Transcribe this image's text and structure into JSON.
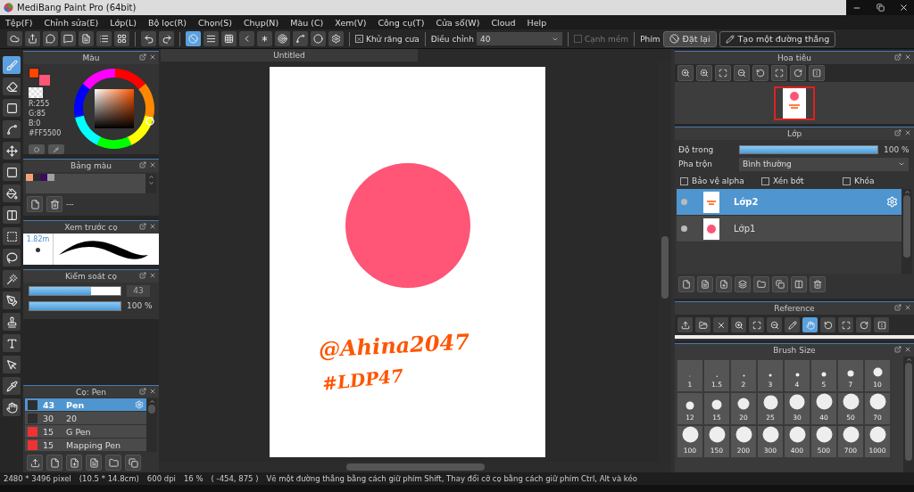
{
  "window": {
    "title": "MediBang Paint Pro (64bit)"
  },
  "menu": [
    "Tệp(F)",
    "Chỉnh sửa(E)",
    "Lớp(L)",
    "Bộ lọc(R)",
    "Chọn(S)",
    "Chụp(N)",
    "Màu (C)",
    "Xem(V)",
    "Công cụ(T)",
    "Cửa sổ(W)",
    "Cloud",
    "Help"
  ],
  "toolbar": {
    "rulers": [
      {
        "selected": true
      },
      {
        "selected": false
      },
      {
        "selected": false
      },
      {
        "selected": false
      },
      {
        "selected": false
      },
      {
        "selected": false
      },
      {
        "selected": false
      },
      {
        "selected": false
      },
      {
        "selected": false
      }
    ],
    "antialias": {
      "label": "Khử răng cưa",
      "checked": true
    },
    "adjust": {
      "label": "Điều chỉnh",
      "value": "40"
    },
    "soft_edge": {
      "label": "Cạnh mềm",
      "checked": false,
      "disabled": true
    },
    "key_label": "Phím",
    "reset_button": "Đặt lại",
    "line_button": "Tạo một đường thẳng"
  },
  "tools": [
    {
      "selected": true
    },
    {
      "selected": false
    },
    {
      "selected": false
    },
    {
      "selected": false
    },
    {
      "selected": false
    },
    {
      "selected": false
    },
    {
      "selected": false
    },
    {
      "selected": false
    },
    {
      "selected": false
    },
    {
      "selected": false
    },
    {
      "selected": false
    },
    {
      "selected": false
    },
    {
      "selected": false
    },
    {
      "selected": false
    },
    {
      "selected": false
    },
    {
      "selected": false
    },
    {
      "selected": false
    }
  ],
  "color_panel": {
    "title": "Màu",
    "main": {
      "color": "#ff4400"
    },
    "sub": {
      "color": "#ff5577"
    },
    "rgb": [
      "R:255",
      "G:85",
      "B:0"
    ],
    "hex": "#FF5500"
  },
  "palette": {
    "title": "Bảng màu",
    "swatches": [
      {
        "color": "#f4a07a"
      },
      {
        "color": "#2b2b2b"
      },
      {
        "color": "#3c0a5c"
      },
      {
        "color": "#a0a0a0"
      }
    ],
    "note": "---"
  },
  "brush_preview": {
    "title": "Xem trước cọ",
    "size": "1.82m"
  },
  "brush_control": {
    "title": "Kiểm soát cọ",
    "size": {
      "level": 0.68,
      "reading": "43"
    },
    "opacity": {
      "level": 1,
      "reading": "100 %"
    }
  },
  "brushes": {
    "title": "Cọ: Pen",
    "items": [
      {
        "size": "43",
        "name": "Pen",
        "color": "#2e2e2e",
        "selected": true
      },
      {
        "size": "30",
        "name": "20",
        "color": "#2e2e2e",
        "selected": false
      },
      {
        "size": "15",
        "name": "G Pen",
        "color": "#ee3333",
        "selected": false
      },
      {
        "size": "15",
        "name": "Mapping Pen",
        "color": "#ee3333",
        "selected": false
      }
    ]
  },
  "canvas": {
    "tab": "Untitled",
    "handwriting": [
      "@Ahina2047",
      "#LDP47"
    ]
  },
  "navigator": {
    "title": "Hoa tiêu"
  },
  "layers": {
    "title": "Lớp",
    "opacity": {
      "label": "Độ trong",
      "level": 1,
      "reading": "100 %"
    },
    "blend": {
      "label": "Pha trộn",
      "value": "Bình thường"
    },
    "options": [
      {
        "label": "Bảo vệ alpha",
        "checked": false
      },
      {
        "label": "Xén bớt",
        "checked": false
      },
      {
        "label": "Khóa",
        "checked": false
      }
    ],
    "items": [
      {
        "name": "Lớp2",
        "selected": true
      },
      {
        "name": "Lớp1",
        "selected": false
      }
    ]
  },
  "reference": {
    "title": "Reference",
    "tools": [
      {
        "selected": false
      },
      {
        "selected": false
      },
      {
        "selected": false
      },
      {
        "selected": false
      },
      {
        "selected": false
      },
      {
        "selected": false
      },
      {
        "selected": false
      },
      {
        "selected": true
      },
      {
        "selected": false
      },
      {
        "selected": false
      },
      {
        "selected": false
      },
      {
        "selected": false
      }
    ]
  },
  "brush_size": {
    "title": "Brush Size",
    "sizes": [
      "1",
      "1.5",
      "2",
      "3",
      "4",
      "5",
      "7",
      "10",
      "12",
      "15",
      "20",
      "25",
      "30",
      "40",
      "50",
      "70",
      "100",
      "150",
      "200",
      "300",
      "400",
      "500",
      "700",
      "1000"
    ]
  },
  "status_bar": {
    "pixels": "2480 * 3496 pixel",
    "physical": "(10.5 * 14.8cm)",
    "dpi": "600 dpi",
    "zoom": "16 %",
    "position": "( -454, 875 )",
    "hint": "Vẽ một đường thẳng bằng cách giữ phím Shift, Thay đổi cỡ cọ bằng cách giữ phím Ctrl, Alt và kéo"
  }
}
